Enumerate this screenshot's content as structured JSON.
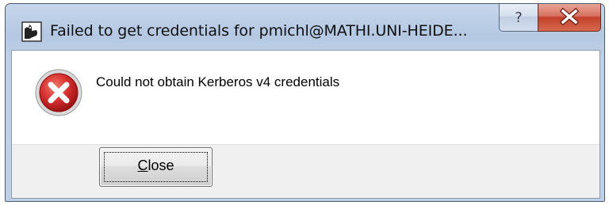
{
  "window": {
    "title": "Failed to get credentials for pmichl@MATHI.UNI-HEIDE...",
    "help_glyph": "?",
    "close_glyph": "x"
  },
  "dialog": {
    "icon": "error-icon",
    "message": "Could not obtain Kerberos v4 credentials",
    "button_label": "Close",
    "button_mnemonic": "C"
  },
  "colors": {
    "error_red": "#c8282c",
    "titlebar_close_red": "#c3412b",
    "titlebar_glass": "#b4c8e2"
  }
}
